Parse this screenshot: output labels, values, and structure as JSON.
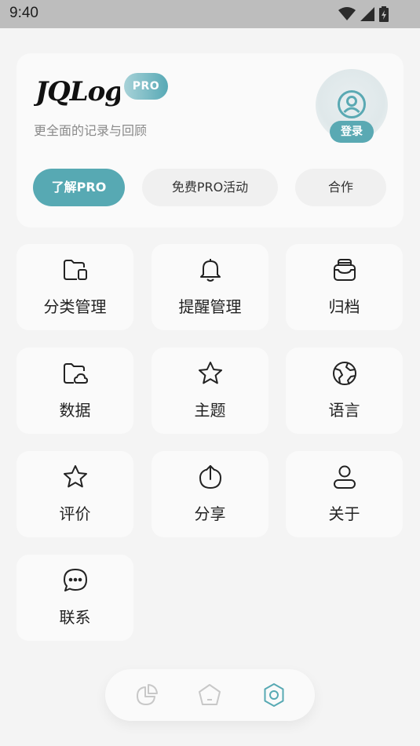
{
  "status_bar": {
    "time": "9:40"
  },
  "header": {
    "logo_text": "JQLog",
    "pro_badge": "PRO",
    "tagline": "更全面的记录与回顾",
    "login_label": "登录",
    "buttons": {
      "learn_pro": "了解PRO",
      "free_pro": "免费PRO活动",
      "cooperate": "合作"
    }
  },
  "tiles": [
    {
      "label": "分类管理",
      "icon": "folder-icon"
    },
    {
      "label": "提醒管理",
      "icon": "bell-icon"
    },
    {
      "label": "归档",
      "icon": "archive-icon"
    },
    {
      "label": "数据",
      "icon": "folder-cloud-icon"
    },
    {
      "label": "主题",
      "icon": "star-icon"
    },
    {
      "label": "语言",
      "icon": "globe-icon"
    },
    {
      "label": "评价",
      "icon": "star-outline-icon"
    },
    {
      "label": "分享",
      "icon": "share-icon"
    },
    {
      "label": "关于",
      "icon": "user-icon"
    },
    {
      "label": "联系",
      "icon": "chat-icon"
    }
  ],
  "bottom_nav": [
    {
      "name": "statistics",
      "icon": "pie-chart-icon",
      "active": false
    },
    {
      "name": "home",
      "icon": "home-icon",
      "active": false
    },
    {
      "name": "settings",
      "icon": "gear-icon",
      "active": true
    }
  ],
  "colors": {
    "accent": "#57a9b3",
    "background": "#f4f4f4",
    "card": "#fafafa"
  }
}
